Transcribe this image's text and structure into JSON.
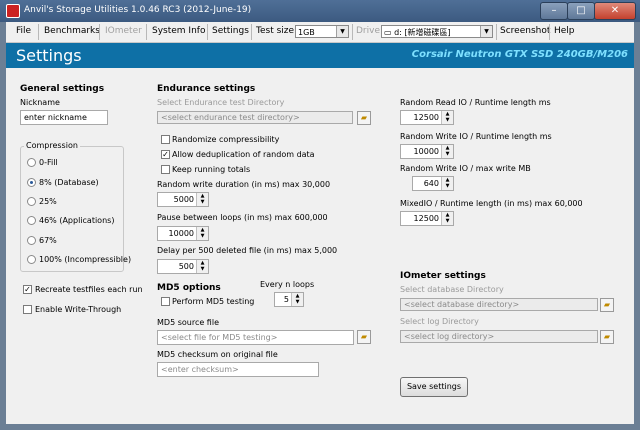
{
  "window": {
    "title": "Anvil's Storage Utilities 1.0.46 RC3 (2012-June-19)",
    "minimize": "–",
    "maximize": "□",
    "close": "✕"
  },
  "menu": {
    "file": "File",
    "benchmarks": "Benchmarks",
    "iometer": "IOmeter",
    "system_info": "System Info",
    "settings": "Settings",
    "test_size_label": "Test size",
    "test_size_value": "1GB",
    "drive_label": "Drive",
    "drive_value": "d: [新增磁碟區]",
    "screenshot": "Screenshot",
    "help": "Help"
  },
  "header": {
    "title": "Settings",
    "drive_name": "Corsair Neutron GTX SSD 240GB/M206"
  },
  "general": {
    "heading": "General settings",
    "nickname_label": "Nickname",
    "nickname_value": "enter nickname",
    "compression_label": "Compression",
    "compression_options": [
      "0-Fill",
      "8% (Database)",
      "25%",
      "46% (Applications)",
      "67%",
      "100% (Incompressible)"
    ],
    "compression_selected": 1,
    "recreate_label": "Recreate testfiles each run",
    "recreate_checked": true,
    "write_through_label": "Enable Write-Through",
    "write_through_checked": false
  },
  "endurance": {
    "heading": "Endurance settings",
    "dir_label": "Select Endurance test Directory",
    "dir_value": "<select endurance test directory>",
    "randomize_label": "Randomize compressibility",
    "randomize_checked": false,
    "dedup_label": "Allow deduplication of random data",
    "dedup_checked": true,
    "keep_totals_label": "Keep running totals",
    "keep_totals_checked": false,
    "rw_duration_label": "Random write duration (in ms) max 30,000",
    "rw_duration_value": "5000",
    "pause_label": "Pause between loops (in ms) max 600,000",
    "pause_value": "10000",
    "delay_label": "Delay per 500 deleted file (in ms) max 5,000",
    "delay_value": "500"
  },
  "md5": {
    "heading": "MD5 options",
    "perform_label": "Perform MD5 testing",
    "perform_checked": false,
    "every_n_label": "Every n loops",
    "every_n_value": "5",
    "source_label": "MD5 source file",
    "source_value": "<select file for MD5 testing>",
    "checksum_label": "MD5 checksum on original file",
    "checksum_value": "<enter checksum>"
  },
  "runtime": {
    "rr_label": "Random Read IO / Runtime length ms",
    "rr_value": "12500",
    "rw_label": "Random Write IO / Runtime length ms",
    "rw_value": "10000",
    "rwmax_label": "Random Write IO / max write MB",
    "rwmax_value": "640",
    "mixed_label": "MixedIO / Runtime length (in ms) max 60,000",
    "mixed_value": "12500"
  },
  "iometer": {
    "heading": "IOmeter settings",
    "db_dir_label": "Select database Directory",
    "db_dir_value": "<select database directory>",
    "log_dir_label": "Select log Directory",
    "log_dir_value": "<select log directory>"
  },
  "save_button": "Save settings",
  "icons": {
    "browse": "folder-icon",
    "dropdown": "chevron-down-icon",
    "spin": "spin-arrows-icon"
  },
  "colors": {
    "header_bg": "#0e70a6",
    "drive_text": "#7ee0ff"
  }
}
